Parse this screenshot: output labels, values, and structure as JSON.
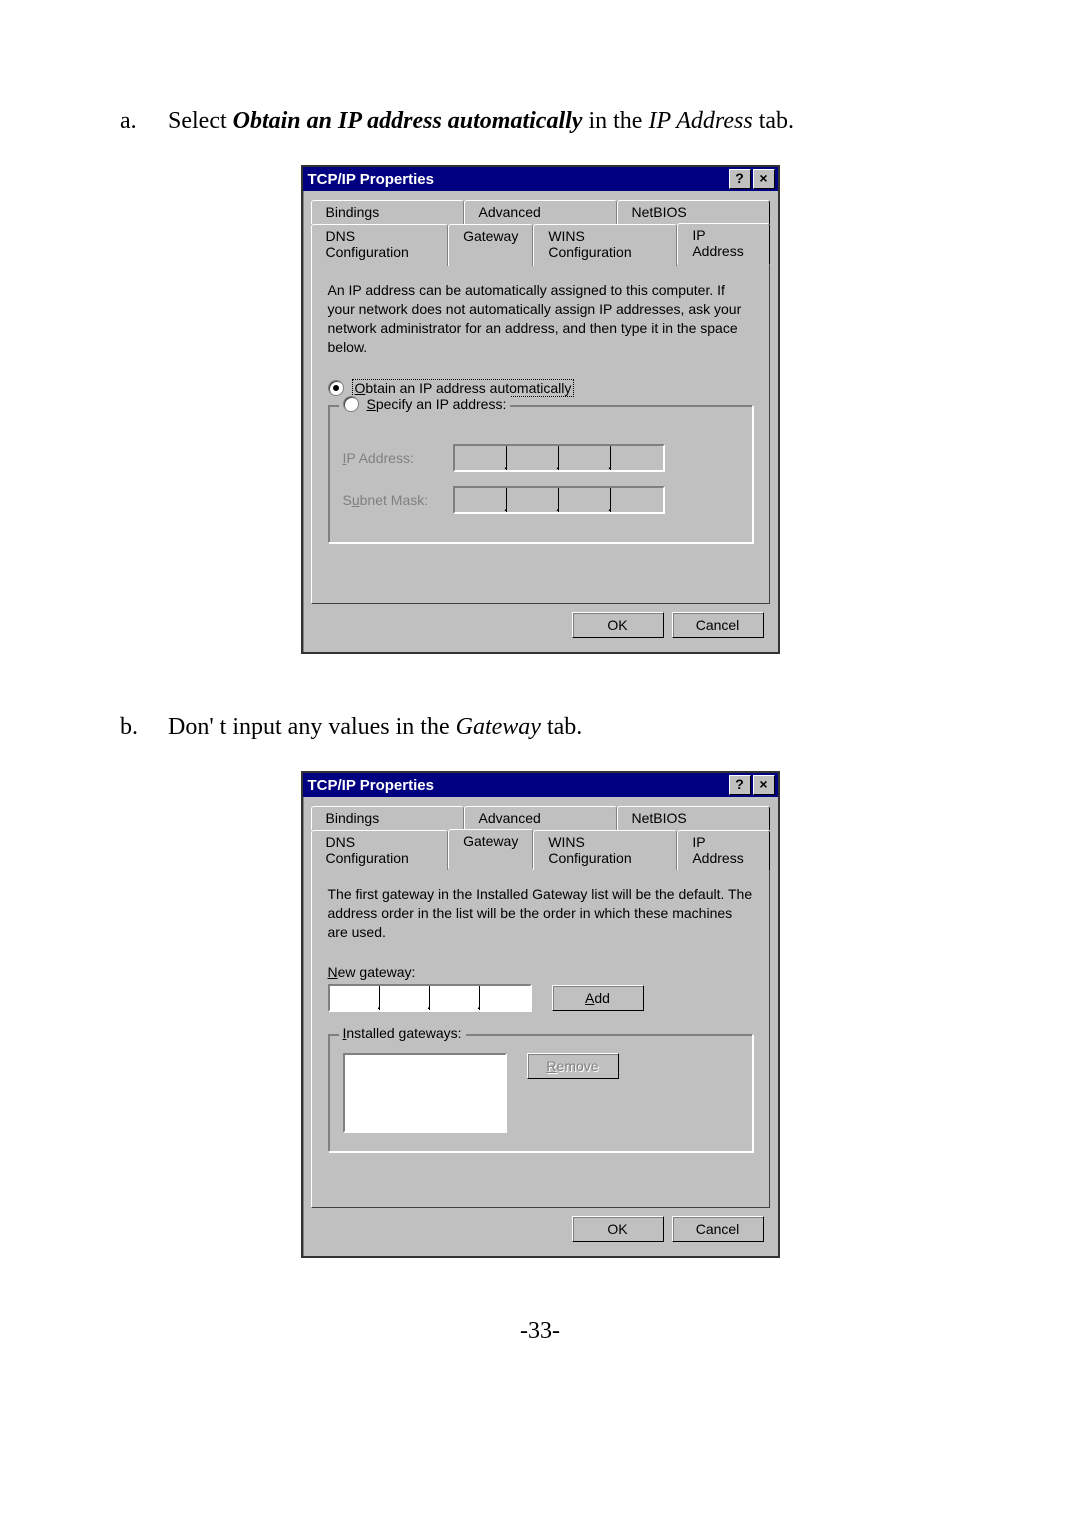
{
  "instruction_a": {
    "letter": "a.",
    "prefix": "Select ",
    "bold": "Obtain an IP address automatically",
    "mid": " in the ",
    "italic": "IP Address",
    "suffix": " tab."
  },
  "instruction_b": {
    "letter": "b.",
    "prefix": "Don' t input any values in the ",
    "italic": "Gateway",
    "suffix": " tab."
  },
  "dialog1": {
    "title": "TCP/IP Properties",
    "help_glyph": "?",
    "close_glyph": "×",
    "tabs_top": [
      "Bindings",
      "Advanced",
      "NetBIOS"
    ],
    "tabs_bottom": [
      "DNS Configuration",
      "Gateway",
      "WINS Configuration",
      "IP Address"
    ],
    "active_tab": "IP Address",
    "description": "An IP address can be automatically assigned to this computer. If your network does not automatically assign IP addresses, ask your network administrator for an address, and then type it in the space below.",
    "radio_obtain": "Obtain an IP address automatically",
    "radio_specify": "Specify an IP address:",
    "ip_label": "IP Address:",
    "mask_label": "Subnet Mask:",
    "ok": "OK",
    "cancel": "Cancel"
  },
  "dialog2": {
    "title": "TCP/IP Properties",
    "help_glyph": "?",
    "close_glyph": "×",
    "tabs_top": [
      "Bindings",
      "Advanced",
      "NetBIOS"
    ],
    "tabs_bottom": [
      "DNS Configuration",
      "Gateway",
      "WINS Configuration",
      "IP Address"
    ],
    "active_tab": "Gateway",
    "description": "The first gateway in the Installed Gateway list will be the default. The address order in the list will be the order in which these machines are used.",
    "new_gateway_label": "New gateway:",
    "add_btn": "Add",
    "installed_label": "Installed gateways:",
    "remove_btn": "Remove",
    "ok": "OK",
    "cancel": "Cancel"
  },
  "page_number": "-33-"
}
